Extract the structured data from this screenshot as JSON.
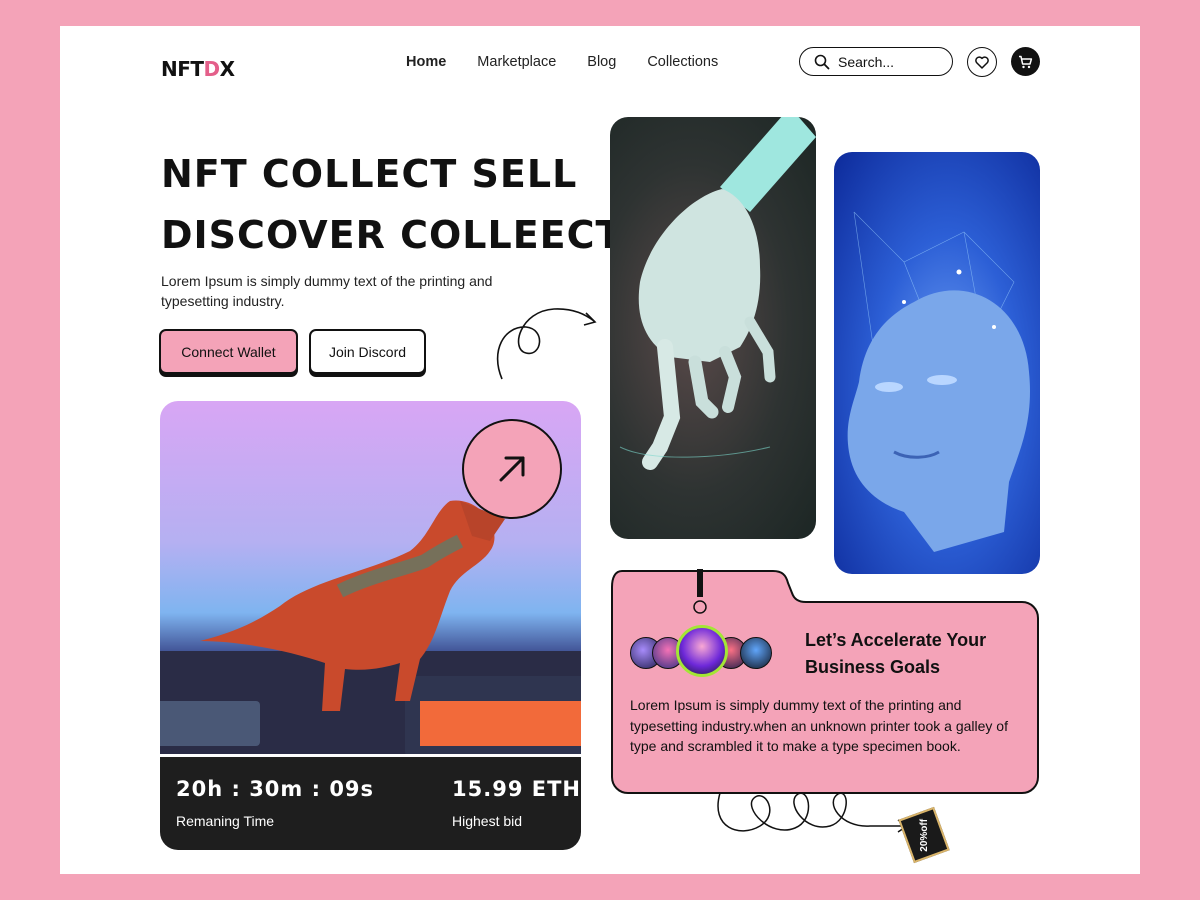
{
  "logo": {
    "main": "NFT",
    "accent": "D",
    "tail": "X"
  },
  "nav": [
    {
      "label": "Home",
      "active": true
    },
    {
      "label": "Marketplace"
    },
    {
      "label": "Blog"
    },
    {
      "label": "Collections"
    }
  ],
  "search": {
    "placeholder": "Search..."
  },
  "hero": {
    "line1": "NFT COLLECT SELL",
    "line2": "DISCOVER COLLEECT",
    "subtitle": "Lorem Ipsum is simply dummy text of the printing and typesetting industry.",
    "connect_label": "Connect Wallet",
    "discord_label": "Join Discord"
  },
  "auction": {
    "time": "20h : 30m : 09s",
    "time_label": "Remaning Time",
    "bid": "15.99 ETH",
    "bid_label": "Highest bid"
  },
  "info": {
    "title": "Let’s Accelerate Your Business Goals",
    "text": "Lorem Ipsum is simply dummy text of the printing and typesetting industry.when an unknown printer took a galley of type and scrambled it to make a type specimen book."
  },
  "tag": {
    "label": "20%off"
  },
  "colors": {
    "accent_pink": "#f4a3b8",
    "dark": "#1e1e1e",
    "logo_accent": "#e45f8a"
  }
}
